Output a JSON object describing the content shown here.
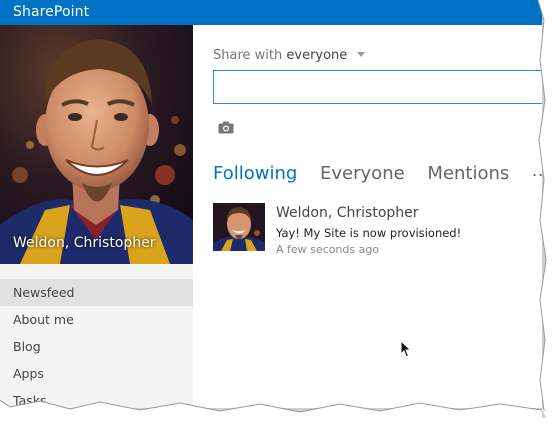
{
  "app": {
    "brand": "SharePoint",
    "accent_color": "#0072c6"
  },
  "profile": {
    "name": "Weldon, Christopher"
  },
  "nav": {
    "items": [
      {
        "label": "Newsfeed",
        "active": true
      },
      {
        "label": "About me",
        "active": false
      },
      {
        "label": "Blog",
        "active": false
      },
      {
        "label": "Apps",
        "active": false
      },
      {
        "label": "Tasks",
        "active": false
      }
    ]
  },
  "share": {
    "prefix": "Share with",
    "audience": "everyone",
    "input_value": ""
  },
  "tabs": [
    {
      "label": "Following",
      "active": true
    },
    {
      "label": "Everyone",
      "active": false
    },
    {
      "label": "Mentions",
      "active": false
    }
  ],
  "more_label": "...",
  "feed": [
    {
      "author": "Weldon, Christopher",
      "text": "Yay! My Site is now provisioned!",
      "time": "A few seconds ago"
    }
  ]
}
